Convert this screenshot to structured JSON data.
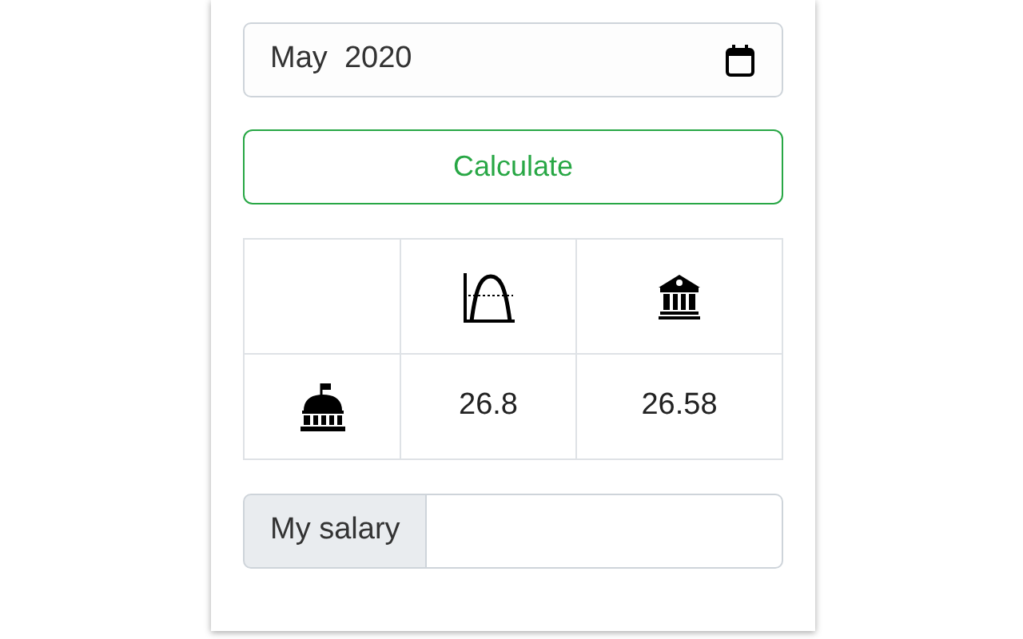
{
  "month_field": {
    "value": "May  2020"
  },
  "calculate_button": {
    "label": "Calculate"
  },
  "table": {
    "rows": [
      {
        "values": [
          "26.8",
          "26.58"
        ]
      }
    ]
  },
  "salary_field": {
    "label": "My salary"
  }
}
